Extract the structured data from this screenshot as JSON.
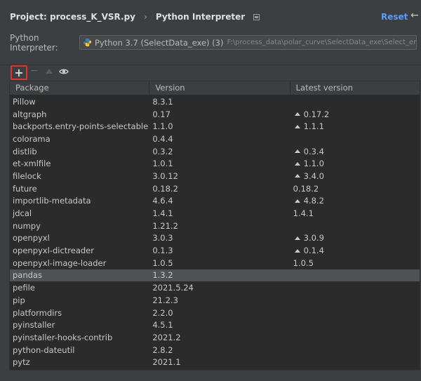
{
  "header": {
    "project": "Project: process_K_VSR.py",
    "separator": "›",
    "page": "Python Interpreter",
    "reset_label": "Reset",
    "back_icon": "arrow-left-icon"
  },
  "interpreter": {
    "label": "Python Interpreter:",
    "name": "Python 3.7 (SelectData_exe) (3)",
    "path": "F:\\process_data\\polar_curve\\SelectData_exe\\Select_env\\Scripts\\pytho"
  },
  "toolbar": {
    "add": "+",
    "remove": "−",
    "icons": [
      "plus-icon",
      "minus-icon",
      "upgrade-icon",
      "eye-icon"
    ]
  },
  "table": {
    "columns": [
      "Package",
      "Version",
      "Latest version"
    ],
    "rows": [
      {
        "package": "Pillow",
        "version": "8.3.1",
        "latest": "",
        "upgrade": false
      },
      {
        "package": "altgraph",
        "version": "0.17",
        "latest": "0.17.2",
        "upgrade": true
      },
      {
        "package": "backports.entry-points-selectable",
        "version": "1.1.0",
        "latest": "1.1.1",
        "upgrade": true
      },
      {
        "package": "colorama",
        "version": "0.4.4",
        "latest": "",
        "upgrade": false
      },
      {
        "package": "distlib",
        "version": "0.3.2",
        "latest": "0.3.4",
        "upgrade": true
      },
      {
        "package": "et-xmlfile",
        "version": "1.0.1",
        "latest": "1.1.0",
        "upgrade": true
      },
      {
        "package": "filelock",
        "version": "3.0.12",
        "latest": "3.4.0",
        "upgrade": true
      },
      {
        "package": "future",
        "version": "0.18.2",
        "latest": "0.18.2",
        "upgrade": false
      },
      {
        "package": "importlib-metadata",
        "version": "4.6.4",
        "latest": "4.8.2",
        "upgrade": true
      },
      {
        "package": "jdcal",
        "version": "1.4.1",
        "latest": "1.4.1",
        "upgrade": false
      },
      {
        "package": "numpy",
        "version": "1.21.2",
        "latest": "",
        "upgrade": false
      },
      {
        "package": "openpyxl",
        "version": "3.0.3",
        "latest": "3.0.9",
        "upgrade": true
      },
      {
        "package": "openpyxl-dictreader",
        "version": "0.1.3",
        "latest": "0.1.4",
        "upgrade": true
      },
      {
        "package": "openpyxl-image-loader",
        "version": "1.0.5",
        "latest": "1.0.5",
        "upgrade": false
      },
      {
        "package": "pandas",
        "version": "1.3.2",
        "latest": "",
        "upgrade": false,
        "selected": true
      },
      {
        "package": "pefile",
        "version": "2021.5.24",
        "latest": "",
        "upgrade": false
      },
      {
        "package": "pip",
        "version": "21.2.3",
        "latest": "",
        "upgrade": false
      },
      {
        "package": "platformdirs",
        "version": "2.2.0",
        "latest": "",
        "upgrade": false
      },
      {
        "package": "pyinstaller",
        "version": "4.5.1",
        "latest": "",
        "upgrade": false
      },
      {
        "package": "pyinstaller-hooks-contrib",
        "version": "2021.2",
        "latest": "",
        "upgrade": false
      },
      {
        "package": "python-dateutil",
        "version": "2.8.2",
        "latest": "",
        "upgrade": false
      },
      {
        "package": "pytz",
        "version": "2021.1",
        "latest": "",
        "upgrade": false
      }
    ]
  }
}
